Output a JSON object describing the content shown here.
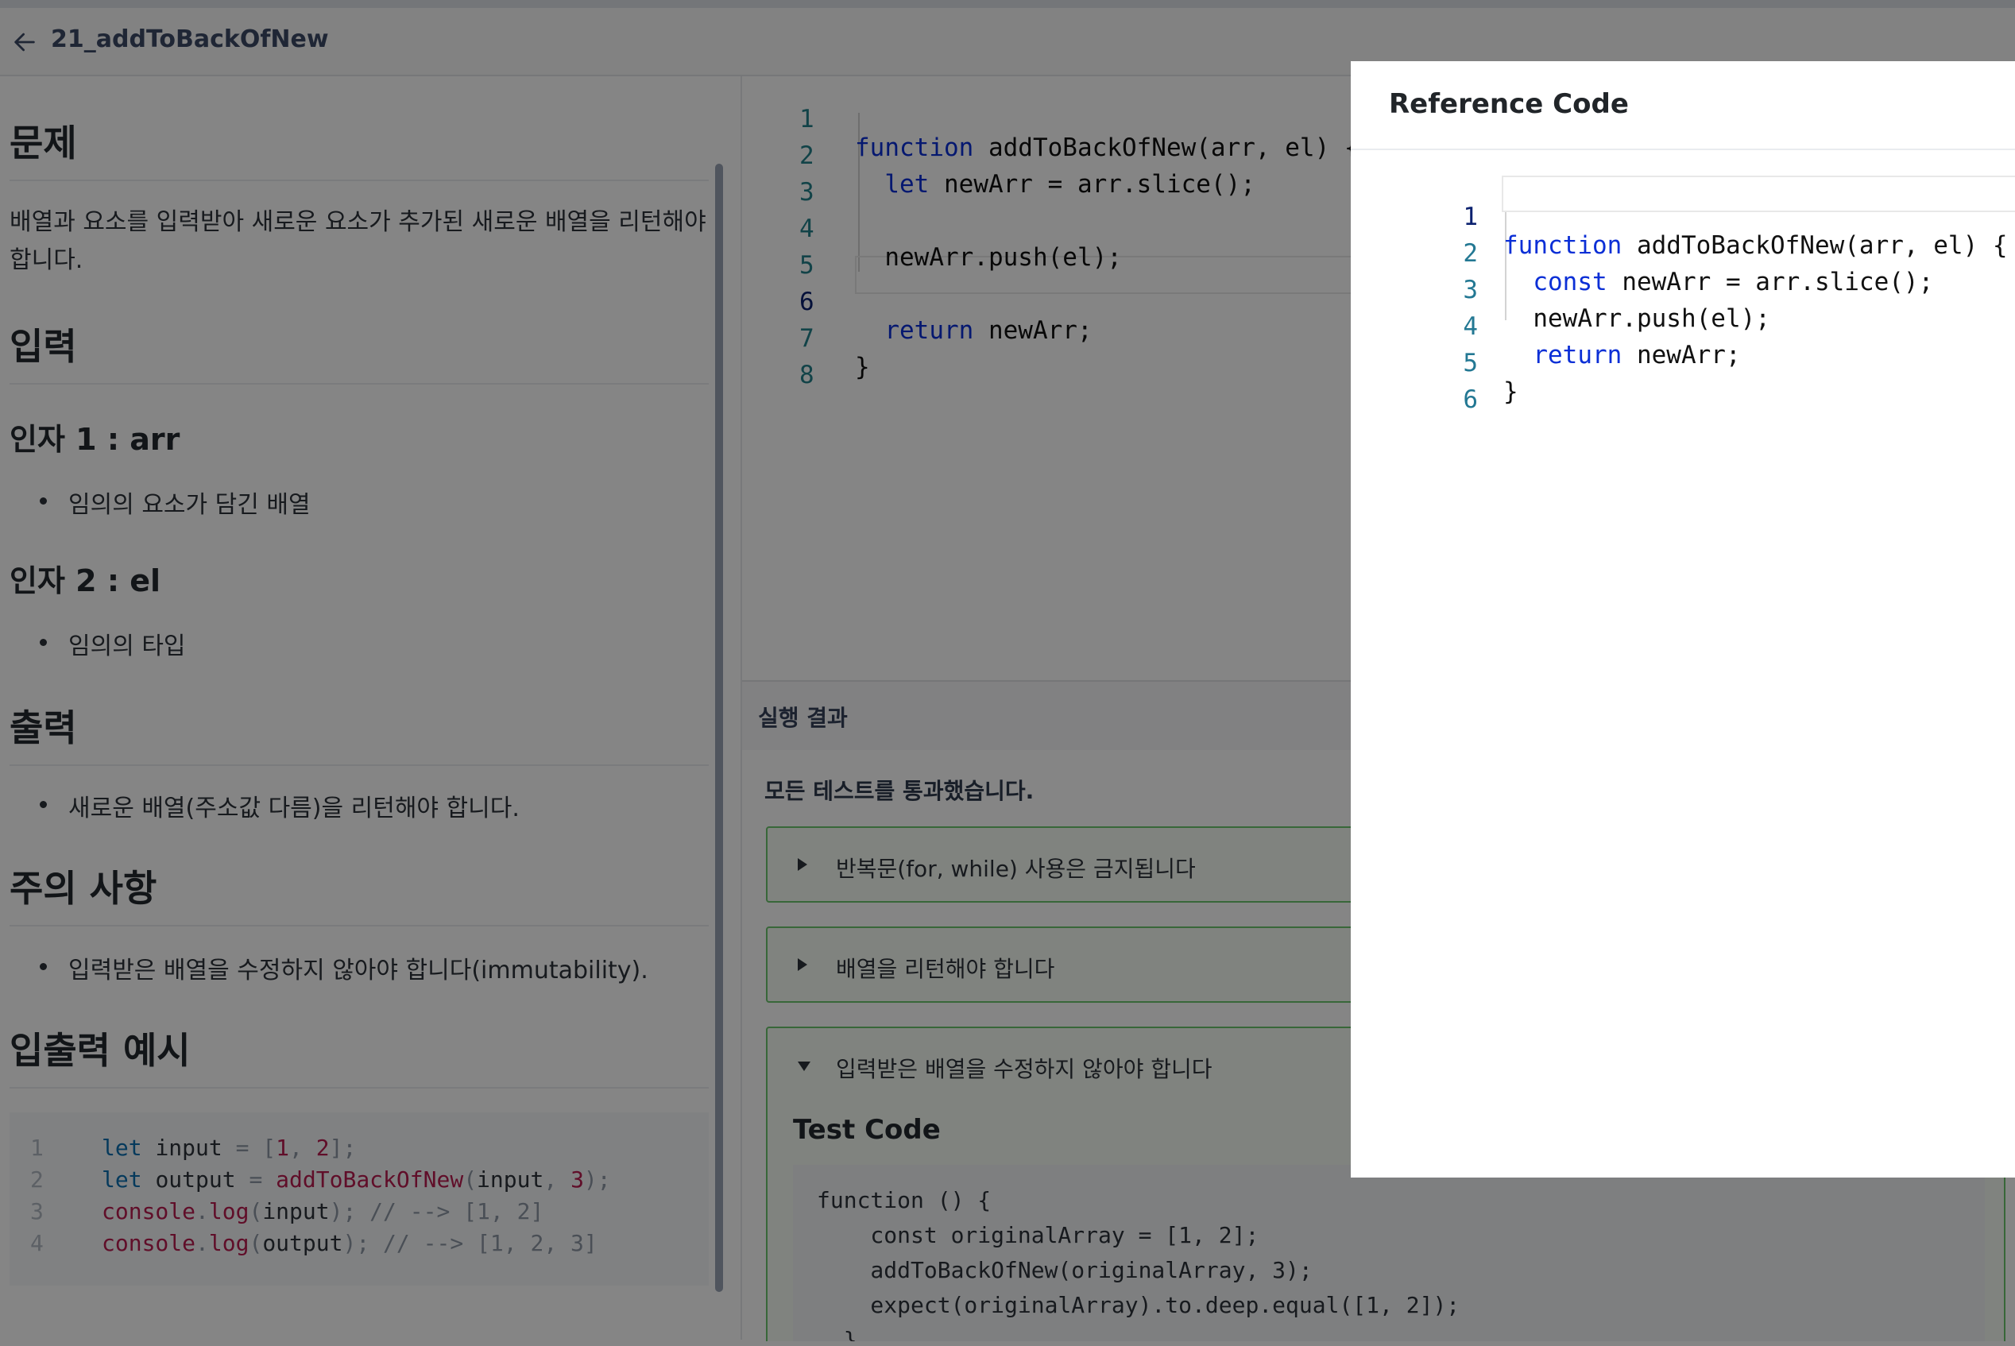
{
  "header": {
    "back_icon": "arrow-left-icon",
    "title": "21_addToBackOfNew"
  },
  "problem": {
    "section_problem": "문제",
    "problem_text_line1": "배열과 요소를 입력받아 새로운 요소가 추가된 새로운 배열을 리턴해야",
    "problem_text_line2": "합니다.",
    "section_input": "입력",
    "arg1_title": "인자 1 : arr",
    "arg1_desc": "임의의 요소가 담긴 배열",
    "arg2_title": "인자 2 : el",
    "arg2_desc": "임의의 타입",
    "section_output": "출력",
    "output_desc": "새로운 배열(주소값 다름)을 리턴해야 합니다.",
    "section_caution": "주의 사항",
    "caution_desc": "입력받은 배열을 수정하지 않아야 합니다(immutability).",
    "section_example": "입출력 예시",
    "example_lines": [
      {
        "num": "1",
        "code": "let input = [1, 2];"
      },
      {
        "num": "2",
        "code": "let output = addToBackOfNew(input, 3);"
      },
      {
        "num": "3",
        "code": "console.log(input); // --> [1, 2]"
      },
      {
        "num": "4",
        "code": "console.log(output); // --> [1, 2, 3]"
      }
    ]
  },
  "editor": {
    "lines": [
      {
        "num": "1",
        "code": "function addToBackOfNew(arr, el) {"
      },
      {
        "num": "2",
        "code": "  let newArr = arr.slice();"
      },
      {
        "num": "3",
        "code": ""
      },
      {
        "num": "4",
        "code": "  newArr.push(el);"
      },
      {
        "num": "5",
        "code": ""
      },
      {
        "num": "6",
        "code": "  return newArr;"
      },
      {
        "num": "7",
        "code": "}"
      },
      {
        "num": "8",
        "code": ""
      }
    ]
  },
  "results": {
    "title": "실행 결과",
    "pass_message": "모든 테스트를 통과했습니다.",
    "tests": [
      {
        "label": "반복문(for, while) 사용은 금지됩니다",
        "expanded": false
      },
      {
        "label": "배열을 리턴해야 합니다",
        "expanded": false
      },
      {
        "label": "입력받은 배열을 수정하지 않아야 합니다",
        "expanded": true
      }
    ],
    "test_code_title": "Test Code",
    "test_code_lines": [
      "function () {",
      "    const originalArray = [1, 2];",
      "    addToBackOfNew(originalArray, 3);",
      "    expect(originalArray).to.deep.equal([1, 2]);",
      "  }"
    ]
  },
  "reference_modal": {
    "title": "Reference Code",
    "lines": [
      {
        "num": "1",
        "code": "function addToBackOfNew(arr, el) {"
      },
      {
        "num": "2",
        "code": "  const newArr = arr.slice();"
      },
      {
        "num": "3",
        "code": "  newArr.push(el);"
      },
      {
        "num": "4",
        "code": "  return newArr;"
      },
      {
        "num": "5",
        "code": "}"
      },
      {
        "num": "6",
        "code": ""
      }
    ]
  },
  "colors": {
    "keyword": "#0b2fd6",
    "line_number": "#237893",
    "pass_border": "#6cc66d",
    "overlay": "rgba(0,0,0,0.48)"
  }
}
